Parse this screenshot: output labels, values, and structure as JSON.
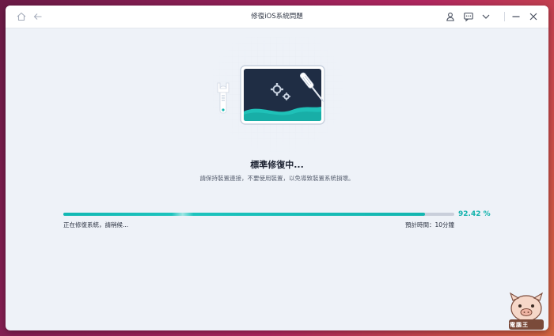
{
  "window": {
    "title": "修復iOS系統問題"
  },
  "toolbar": {
    "home_icon": "home-icon",
    "back_icon": "back-arrow-icon",
    "account_icon": "person-icon",
    "feedback_icon": "message-icon",
    "menu_icon": "chevron-down-icon",
    "minimize_icon": "minimize-icon",
    "close_icon": "close-icon"
  },
  "main": {
    "heading": "標準修復中...",
    "description": "請保持裝置連接，不要使用裝置，以免導致裝置系統損壞。"
  },
  "progress": {
    "value": 0.9242,
    "percent_label": "92.42 %",
    "status_text": "正在修復系統，請稍候...",
    "estimate_text": "預計時間：10分鐘"
  },
  "watermark": {
    "text": "電腦王"
  },
  "colors": {
    "accent": "#13b6b0",
    "track": "#c9cfdb",
    "window_bg": "#eef2f8"
  }
}
